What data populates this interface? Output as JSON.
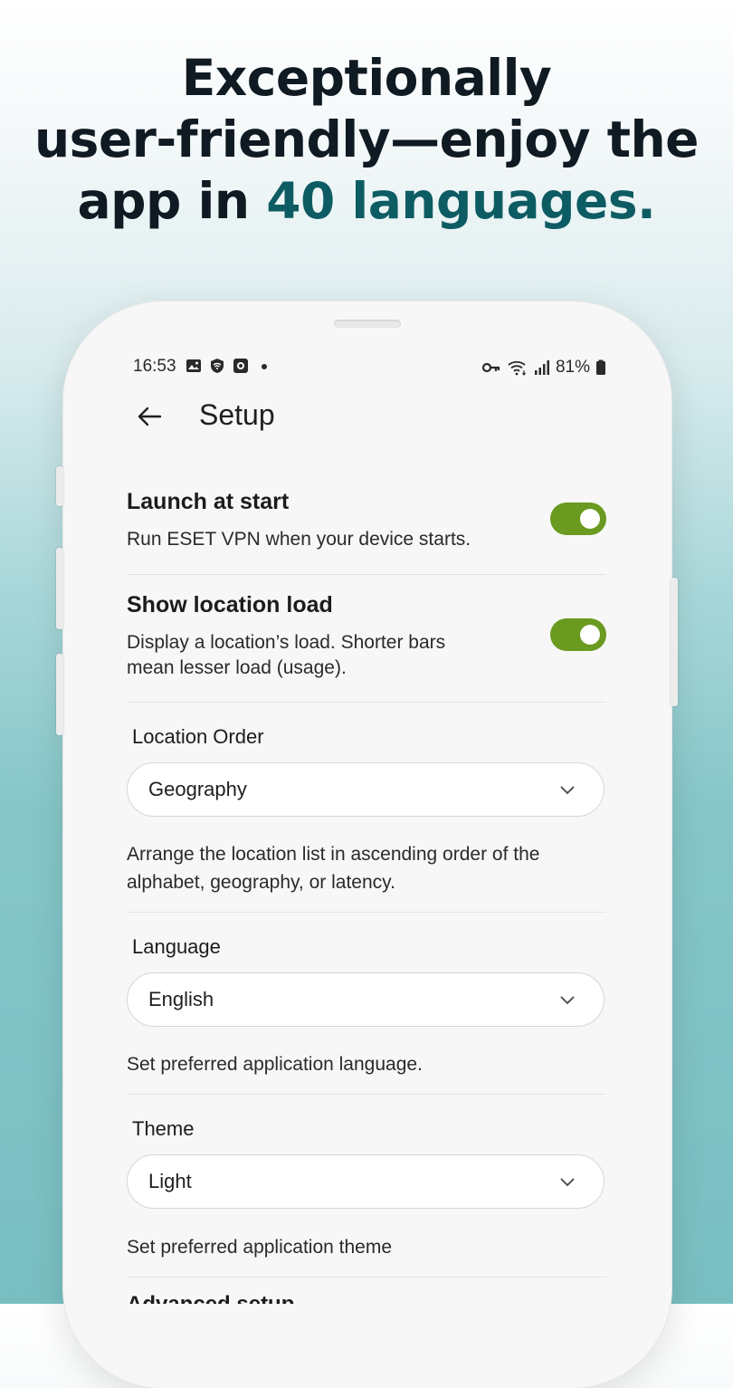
{
  "headline": {
    "line1": "Exceptionally",
    "line2": "user-friendly—enjoy the",
    "line3_prefix": "app in ",
    "line3_highlight": "40 languages."
  },
  "colors": {
    "accent": "#0e5c63",
    "toggle_on": "#6a9a1f"
  },
  "status_bar": {
    "time": "16:53",
    "left_icons": [
      "image-icon",
      "vpn-shield-icon",
      "screen-record-icon",
      "dot-icon"
    ],
    "right_icons": [
      "vpn-key-icon",
      "wifi-icon",
      "signal-icon",
      "battery-icon"
    ],
    "battery": "81%"
  },
  "appbar": {
    "back_icon": "arrow-left-icon",
    "title": "Setup"
  },
  "settings": {
    "launch": {
      "title": "Launch at start",
      "subtitle": "Run ESET VPN when your device starts.",
      "enabled": true
    },
    "location_load": {
      "title": "Show location load",
      "subtitle_line1": "Display a location’s load. Shorter bars",
      "subtitle_line2": "mean lesser load (usage).",
      "enabled": true
    },
    "location_order": {
      "label": "Location Order",
      "value": "Geography",
      "description_line1": "Arrange the location list in ascending order of the",
      "description_line2": "alphabet, geography, or latency."
    },
    "language": {
      "label": "Language",
      "value": "English",
      "description": "Set preferred application language."
    },
    "theme": {
      "label": "Theme",
      "value": "Light",
      "description": "Set preferred application theme"
    },
    "advanced": {
      "label": "Advanced setup"
    }
  }
}
